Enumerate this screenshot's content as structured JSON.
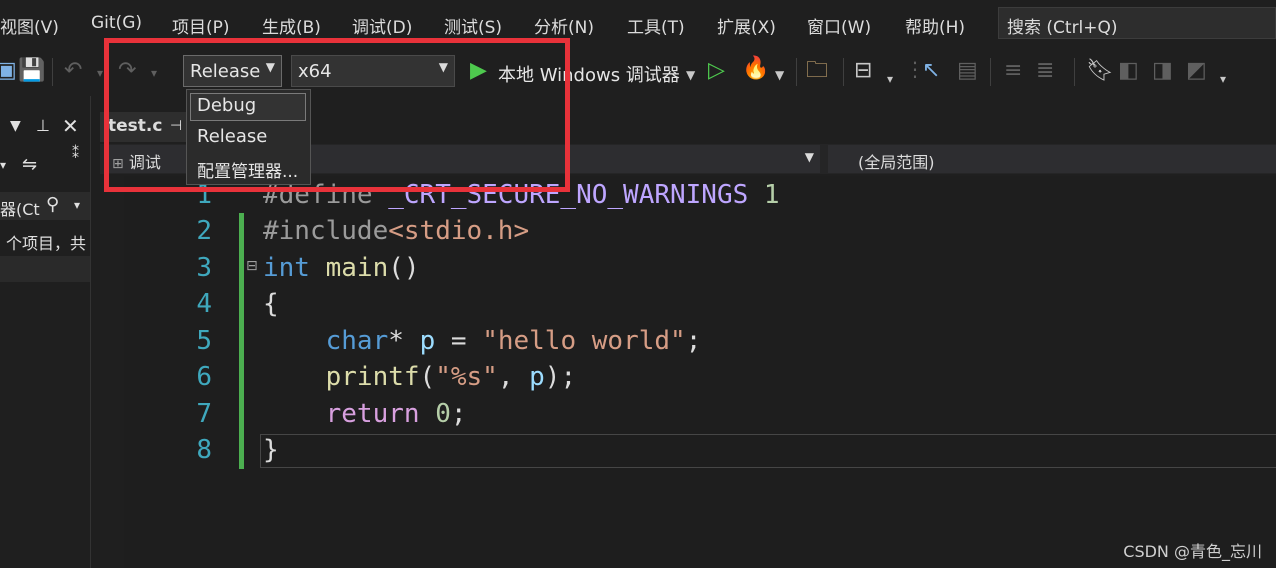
{
  "menu": {
    "items": [
      "视图(V)",
      "Git(G)",
      "项目(P)",
      "生成(B)",
      "调试(D)",
      "测试(S)",
      "分析(N)",
      "工具(T)",
      "扩展(X)",
      "窗口(W)",
      "帮助(H)"
    ],
    "search_placeholder": "搜索 (Ctrl+Q)"
  },
  "toolbar": {
    "configuration": "Release",
    "platform": "x64",
    "run_target": "本地 Windows 调试器",
    "config_options": [
      "Debug",
      "Release",
      "配置管理器..."
    ]
  },
  "left_panel": {
    "search_fragment": "器(Ct",
    "info_fragment": "个项目，共"
  },
  "editor": {
    "tab_name": "test.c",
    "nav_scope": "调试",
    "nav_global": "(全局范围)",
    "line_numbers": [
      "1",
      "2",
      "3",
      "4",
      "5",
      "6",
      "7",
      "8"
    ],
    "code": {
      "l1_directive": "#define",
      "l1_macro": "_CRT_SECURE_NO_WARNINGS",
      "l1_value": "1",
      "l2_directive": "#include",
      "l2_header": "<stdio.h>",
      "l3_type": "int",
      "l3_func": "main",
      "l3_paren": "()",
      "l4": "{",
      "l5_type": "char",
      "l5_star": "*",
      "l5_var": "p",
      "l5_eq": "=",
      "l5_str": "\"hello world\"",
      "l5_semi": ";",
      "l6_func": "printf",
      "l6_open": "(",
      "l6_str": "\"%s\"",
      "l6_comma": ",",
      "l6_var": "p",
      "l6_close": ");",
      "l7_kw": "return",
      "l7_num": "0",
      "l7_semi": ";",
      "l8": "}"
    }
  },
  "watermark": "CSDN @青色_忘川",
  "colors": {
    "highlight": "#e8323a",
    "change_bar": "#4caf50",
    "line_number": "#3fa8bd"
  }
}
